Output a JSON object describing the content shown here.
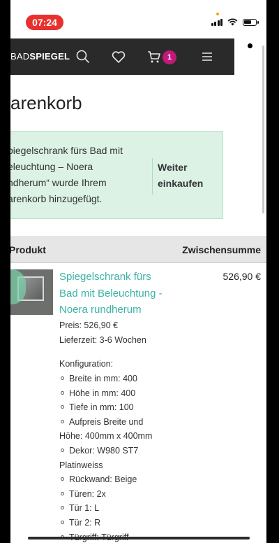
{
  "status_bar": {
    "time": "07:24"
  },
  "header": {
    "logo_prefix": "BAD",
    "logo_suffix": "SPIEGEL",
    "cart_count": "1"
  },
  "page": {
    "title": "arenkorb"
  },
  "notice": {
    "message_lines": [
      "piegelschrank fürs Bad mit",
      "eleuchtung – Noera",
      "ndherum“ wurde Ihrem",
      "arenkorb hinzugefügt."
    ],
    "continue_line1": "Weiter",
    "continue_line2": "einkaufen"
  },
  "table": {
    "col_product": "Produkt",
    "col_subtotal": "Zwischensumme"
  },
  "item": {
    "name_lines": [
      "Spiegelschrank fürs",
      "Bad mit Beleuchtung -",
      "Noera rundherum"
    ],
    "line_total": "526,90 €",
    "price": "Preis: 526,90 €",
    "delivery": "Lieferzeit: 3-6 Wochen",
    "config_title": "Konfiguration:",
    "config": [
      "Breite in mm: 400",
      "Höhe in mm: 400",
      "Tiefe in mm: 100",
      "Aufpreis Breite und",
      "Höhe: 400mm x 400mm",
      "Dekor: W980 ST7",
      "Platinweiss",
      "Rückwand: Beige",
      "Türen: 2x",
      "Tür 1: L",
      "Tür 2: R",
      "Türgriff: Türgriff"
    ]
  }
}
